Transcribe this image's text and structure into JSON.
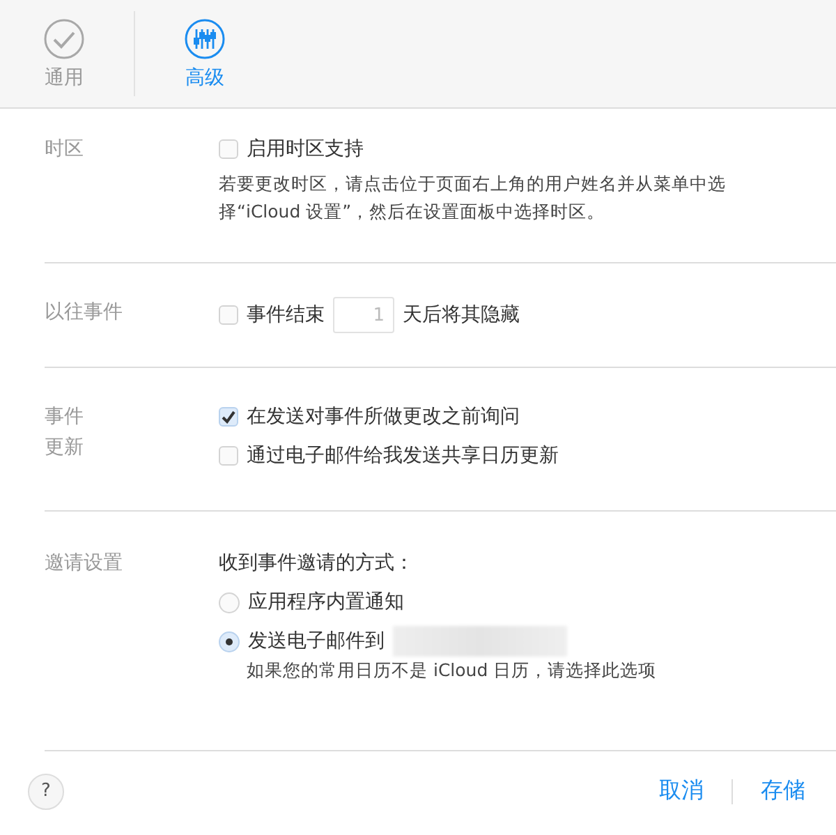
{
  "tabs": [
    {
      "label": "通用",
      "kind": "check",
      "selected": false
    },
    {
      "label": "高级",
      "kind": "sliders",
      "selected": true
    }
  ],
  "sections": [
    {
      "label": [
        "时区"
      ],
      "items": [
        {
          "kind": "checkbox",
          "label": "启用时区支持",
          "checked": false
        },
        {
          "kind": "note",
          "text": "若要更改时区，请点击位于页面右上角的用户姓名并从菜单中选择“iCloud 设置”，然后在设置面板中选择时区。"
        }
      ]
    },
    {
      "label": [
        "以往事件"
      ],
      "items": [
        {
          "kind": "checkbox-days",
          "label": "事件结束",
          "value": "1",
          "suffix": "天后将其隐藏",
          "checked": false
        }
      ]
    },
    {
      "label": [
        "事件",
        "更新"
      ],
      "items": [
        {
          "kind": "checkbox",
          "label": "在发送对事件所做更改之前询问",
          "checked": true
        },
        {
          "kind": "checkbox",
          "label": "通过电子邮件给我发送共享日历更新",
          "checked": false
        }
      ]
    },
    {
      "label": [
        "邀请设置"
      ],
      "items": [
        {
          "kind": "heading",
          "text": "收到事件邀请的方式："
        },
        {
          "kind": "radio",
          "label": "应用程序内置通知",
          "selected": false
        },
        {
          "kind": "radio",
          "label": "发送电子邮件到",
          "selected": true,
          "redacted": true
        },
        {
          "kind": "subnote",
          "text": "如果您的常用日历不是 iCloud 日历，请选择此选项"
        }
      ]
    }
  ],
  "footer": {
    "help": "?",
    "cancel": "取消",
    "save": "存储"
  }
}
